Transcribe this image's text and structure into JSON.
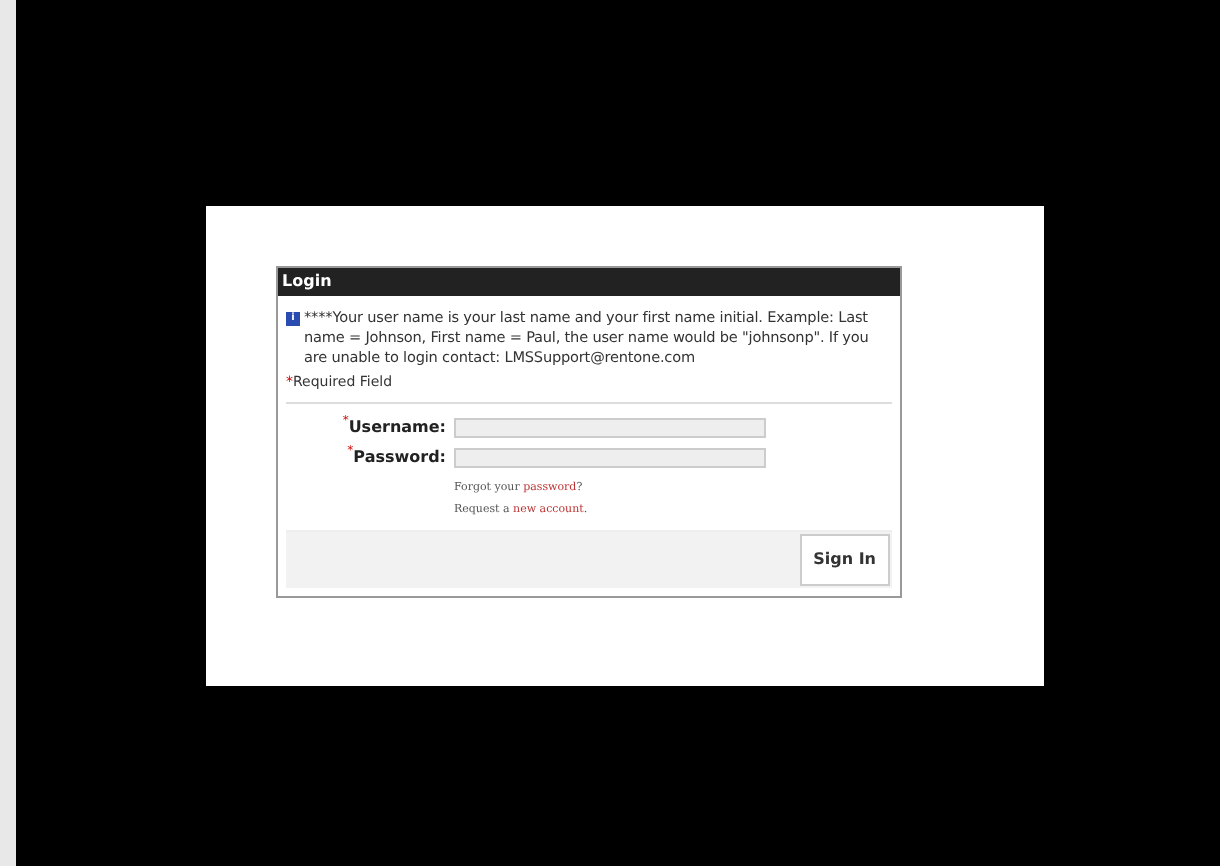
{
  "login": {
    "title": "Login",
    "info_icon": "i",
    "notice": "****Your user name is your last name and your first name initial. Example: Last name = Johnson, First name = Paul, the user name would be \"johnsonp\". If you are unable to login contact: LMSSupport@rentone.com",
    "required_mark": "*",
    "required_note": "Required Field",
    "fields": [
      {
        "label": "Username:",
        "required": true
      },
      {
        "label": "Password:",
        "required": true
      }
    ],
    "links": [
      {
        "before": "Forgot your ",
        "link": "password",
        "after": "?"
      },
      {
        "before": "Request a ",
        "link": "new account",
        "after": "."
      }
    ],
    "button": "Sign In"
  }
}
